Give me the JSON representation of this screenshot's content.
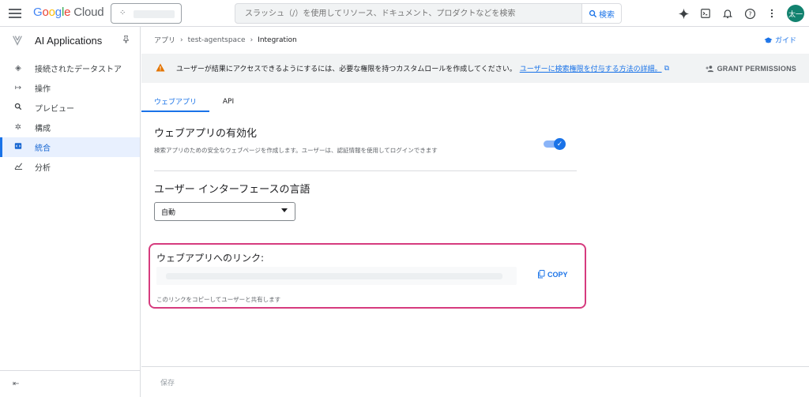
{
  "topbar": {
    "logo": {
      "g": "G",
      "o1": "o",
      "o2": "o",
      "g2": "g",
      "l": "l",
      "e": "e",
      "cloud": " Cloud"
    },
    "search_placeholder": "スラッシュ（/）を使用してリソース、ドキュメント、プロダクトなどを検索",
    "search_button": "検索",
    "avatar_text": "太一"
  },
  "sidebar": {
    "title": "AI Applications",
    "items": [
      {
        "label": "接続されたデータストア",
        "icon": "datastore-icon"
      },
      {
        "label": "操作",
        "icon": "arrows-icon"
      },
      {
        "label": "プレビュー",
        "icon": "search-icon"
      },
      {
        "label": "構成",
        "icon": "gear-icon"
      },
      {
        "label": "統合",
        "icon": "code-icon",
        "active": true
      },
      {
        "label": "分析",
        "icon": "chart-icon"
      }
    ]
  },
  "breadcrumb": {
    "items": [
      "アプリ",
      "test-agentspace",
      "Integration"
    ],
    "guide": "ガイド"
  },
  "banner": {
    "message": "ユーザーが結果にアクセスできるようにするには、必要な権限を持つカスタムロールを作成してください。",
    "link": "ユーザーに検索権限を付与する方法の詳細。",
    "grant": "GRANT PERMISSIONS"
  },
  "tabs": [
    "ウェブアプリ",
    "API"
  ],
  "webapp": {
    "enable_title": "ウェブアプリの有効化",
    "enable_desc": "検索アプリのための安全なウェブページを作成します。ユーザーは、認証情報を使用してログインできます",
    "enabled": true,
    "lang_title": "ユーザー インターフェースの言語",
    "lang_value": "自動",
    "link_title": "ウェブアプリへのリンク:",
    "copy": "COPY",
    "link_hint": "このリンクをコピーしてユーザーと共有します"
  },
  "footer": {
    "save": "保存"
  },
  "colors": {
    "accent": "#1a73e8",
    "highlight_border": "#d63b7e",
    "warning": "#e37400"
  }
}
